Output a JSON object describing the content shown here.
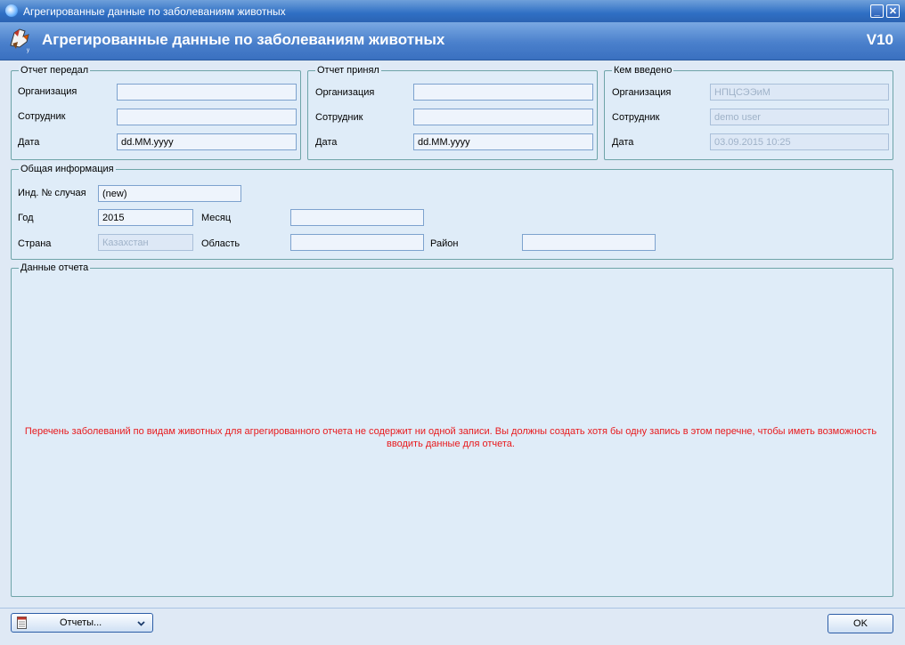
{
  "window": {
    "title": "Агрегированные данные по заболеваниям животных",
    "minimize_glyph": "_",
    "close_glyph": "✕"
  },
  "header": {
    "title": "Агрегированные данные по заболеваниям животных",
    "version": "V10"
  },
  "sent_by": {
    "title": "Отчет передал",
    "organization_label": "Организация",
    "organization_value": "",
    "employee_label": "Сотрудник",
    "employee_value": "",
    "date_label": "Дата",
    "date_value": "dd.MM.yyyy"
  },
  "received_by": {
    "title": "Отчет принял",
    "organization_label": "Организация",
    "organization_value": "",
    "employee_label": "Сотрудник",
    "employee_value": "",
    "date_label": "Дата",
    "date_value": "dd.MM.yyyy"
  },
  "entered_by": {
    "title": "Кем введено",
    "organization_label": "Организация",
    "organization_value": "НПЦСЭЭиМ",
    "employee_label": "Сотрудник",
    "employee_value": "demo user",
    "date_label": "Дата",
    "date_value": "03.09.2015 10:25"
  },
  "general": {
    "title": "Общая информация",
    "case_no_label": "Инд. № случая",
    "case_no_value": "(new)",
    "year_label": "Год",
    "year_value": "2015",
    "month_label": "Месяц",
    "month_value": "",
    "country_label": "Страна",
    "country_value": "Казахстан",
    "region_label": "Область",
    "region_value": "",
    "district_label": "Район",
    "district_value": ""
  },
  "report_data": {
    "title": "Данные отчета",
    "message": "Перечень заболеваний по видам животных для агрегированного отчета не содержит ни одной записи. Вы должны создать хотя бы одну запись в этом перечне, чтобы иметь возможность вводить данные для отчета."
  },
  "footer": {
    "reports_button": "Отчеты...",
    "ok_button": "OK"
  },
  "icons": {
    "app": "globe-icon",
    "logo": "cow-logo-icon",
    "reports": "report-sheet-icon",
    "dropdown": "chevron-down-icon"
  },
  "colors": {
    "titlebar": "#2f6fc4",
    "header": "#4a80cc",
    "message": "#e8191c",
    "group_border": "#6ea4a8"
  }
}
